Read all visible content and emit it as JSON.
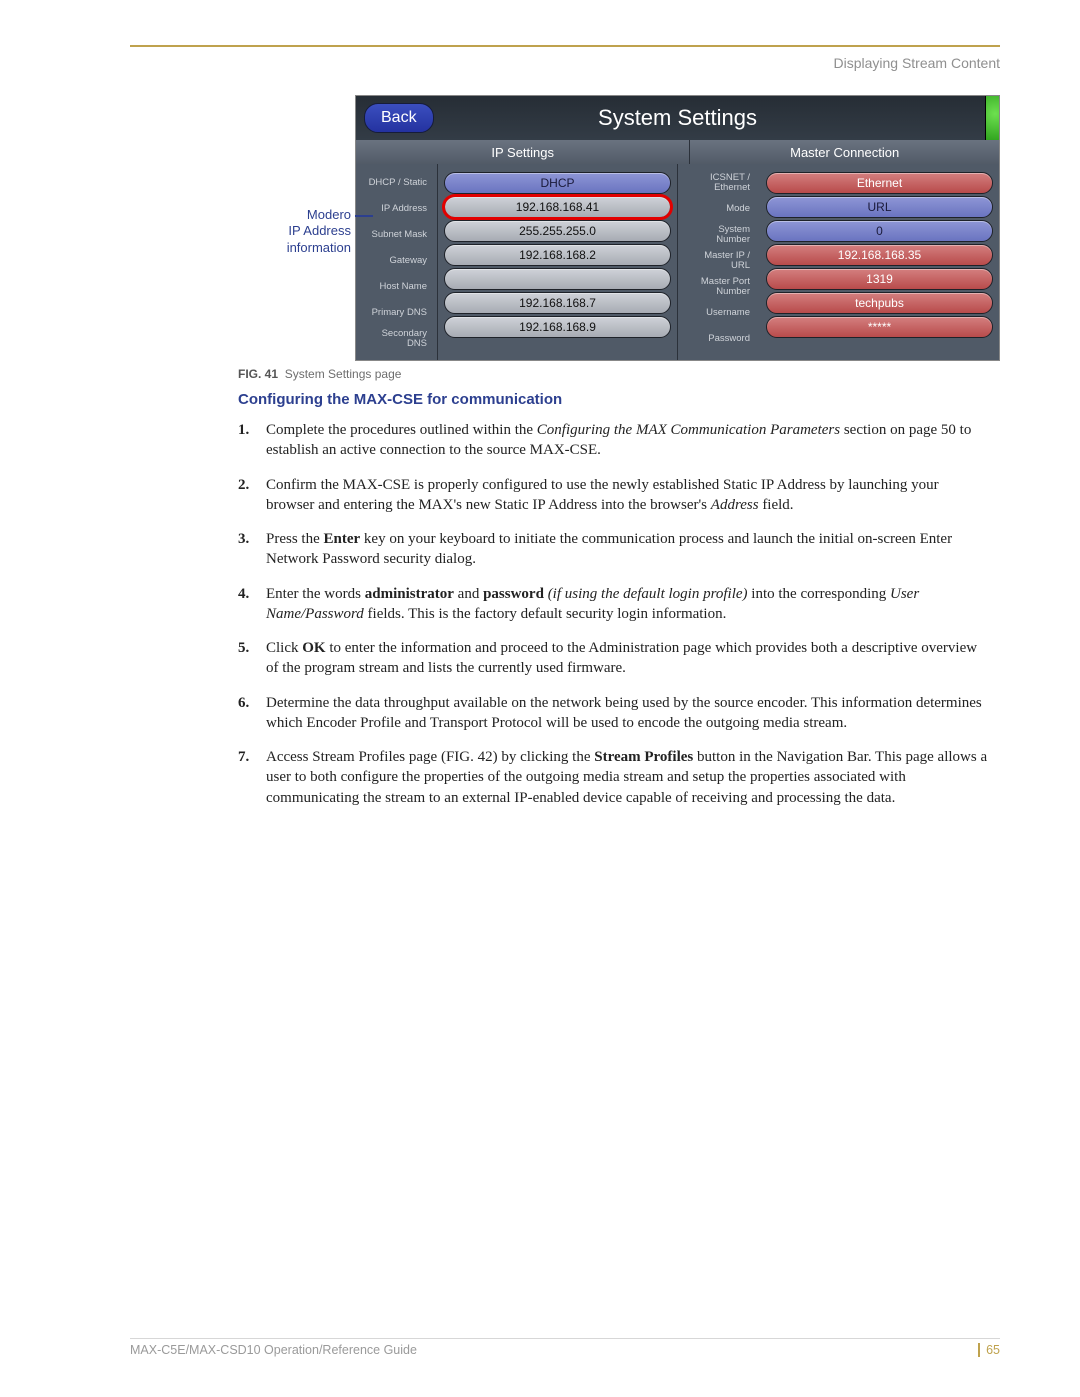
{
  "header": {
    "section_title": "Displaying Stream Content"
  },
  "annotation": {
    "line1": "Modero",
    "line2": "IP Address",
    "line3": "information"
  },
  "screenshot": {
    "back_label": "Back",
    "title": "System Settings",
    "section_left": "IP Settings",
    "section_right": "Master Connection",
    "ip_settings": [
      {
        "label": "DHCP / Static",
        "value": "DHCP",
        "style": "blue"
      },
      {
        "label": "IP Address",
        "value": "192.168.168.41",
        "style": "grey",
        "highlight": true
      },
      {
        "label": "Subnet Mask",
        "value": "255.255.255.0",
        "style": "grey"
      },
      {
        "label": "Gateway",
        "value": "192.168.168.2",
        "style": "grey"
      },
      {
        "label": "Host Name",
        "value": "",
        "style": "grey"
      },
      {
        "label": "Primary DNS",
        "value": "192.168.168.7",
        "style": "grey"
      },
      {
        "label": "Secondary DNS",
        "value": "192.168.168.9",
        "style": "grey"
      }
    ],
    "master_connection": [
      {
        "label": "ICSNET / Ethernet",
        "value": "Ethernet",
        "style": "red"
      },
      {
        "label": "Mode",
        "value": "URL",
        "style": "blue"
      },
      {
        "label": "System Number",
        "value": "0",
        "style": "blue"
      },
      {
        "label": "Master IP / URL",
        "value": "192.168.168.35",
        "style": "red"
      },
      {
        "label": "Master Port Number",
        "value": "1319",
        "style": "red"
      },
      {
        "label": "Username",
        "value": "techpubs",
        "style": "red"
      },
      {
        "label": "Password",
        "value": "*****",
        "style": "red"
      }
    ]
  },
  "caption": {
    "prefix": "FIG. 41",
    "text": "System Settings page"
  },
  "subheading": "Configuring the MAX-CSE for communication",
  "steps": [
    {
      "n": "1.",
      "segments": [
        {
          "t": "Complete the procedures outlined within the "
        },
        {
          "t": "Configuring the MAX Communication Parameters",
          "em": true
        },
        {
          "t": " section on page 50 to establish an active connection to the source MAX-CSE."
        }
      ]
    },
    {
      "n": "2.",
      "segments": [
        {
          "t": "Confirm the MAX-CSE is properly configured to use the newly established Static IP Address by launching your browser and entering the MAX's new Static IP Address into the browser's "
        },
        {
          "t": "Address",
          "em": true
        },
        {
          "t": " field."
        }
      ]
    },
    {
      "n": "3.",
      "segments": [
        {
          "t": "Press the "
        },
        {
          "t": "Enter",
          "strong": true
        },
        {
          "t": " key on your keyboard to initiate the communication process and launch the initial on-screen Enter Network Password security dialog."
        }
      ]
    },
    {
      "n": "4.",
      "segments": [
        {
          "t": "Enter the words "
        },
        {
          "t": "administrator",
          "strong": true
        },
        {
          "t": " and "
        },
        {
          "t": "password",
          "strong": true
        },
        {
          "t": " "
        },
        {
          "t": "(if using the default login profile)",
          "em": true
        },
        {
          "t": " into the corresponding "
        },
        {
          "t": "User Name/Password",
          "em": true
        },
        {
          "t": " fields. This is the factory default security login information."
        }
      ]
    },
    {
      "n": "5.",
      "segments": [
        {
          "t": "Click "
        },
        {
          "t": "OK",
          "strong": true
        },
        {
          "t": " to enter the information and proceed to the Administration page which provides both a descriptive overview of the program stream and lists the currently used firmware."
        }
      ]
    },
    {
      "n": "6.",
      "segments": [
        {
          "t": "Determine the data throughput available on the network being used by the source encoder. This information determines which Encoder Profile and Transport Protocol will be used to encode the outgoing media stream."
        }
      ]
    },
    {
      "n": "7.",
      "segments": [
        {
          "t": "Access Stream Profiles page (FIG. 42) by clicking the "
        },
        {
          "t": "Stream Profiles",
          "strong": true
        },
        {
          "t": " button in the Navigation Bar. This page allows a user to both configure the properties of the outgoing media stream and setup the properties associated with communicating the stream to an external IP-enabled device capable of receiving and processing the data."
        }
      ]
    }
  ],
  "footer": {
    "doc_title": "MAX-C5E/MAX-CSD10 Operation/Reference Guide",
    "page_number": "65"
  }
}
